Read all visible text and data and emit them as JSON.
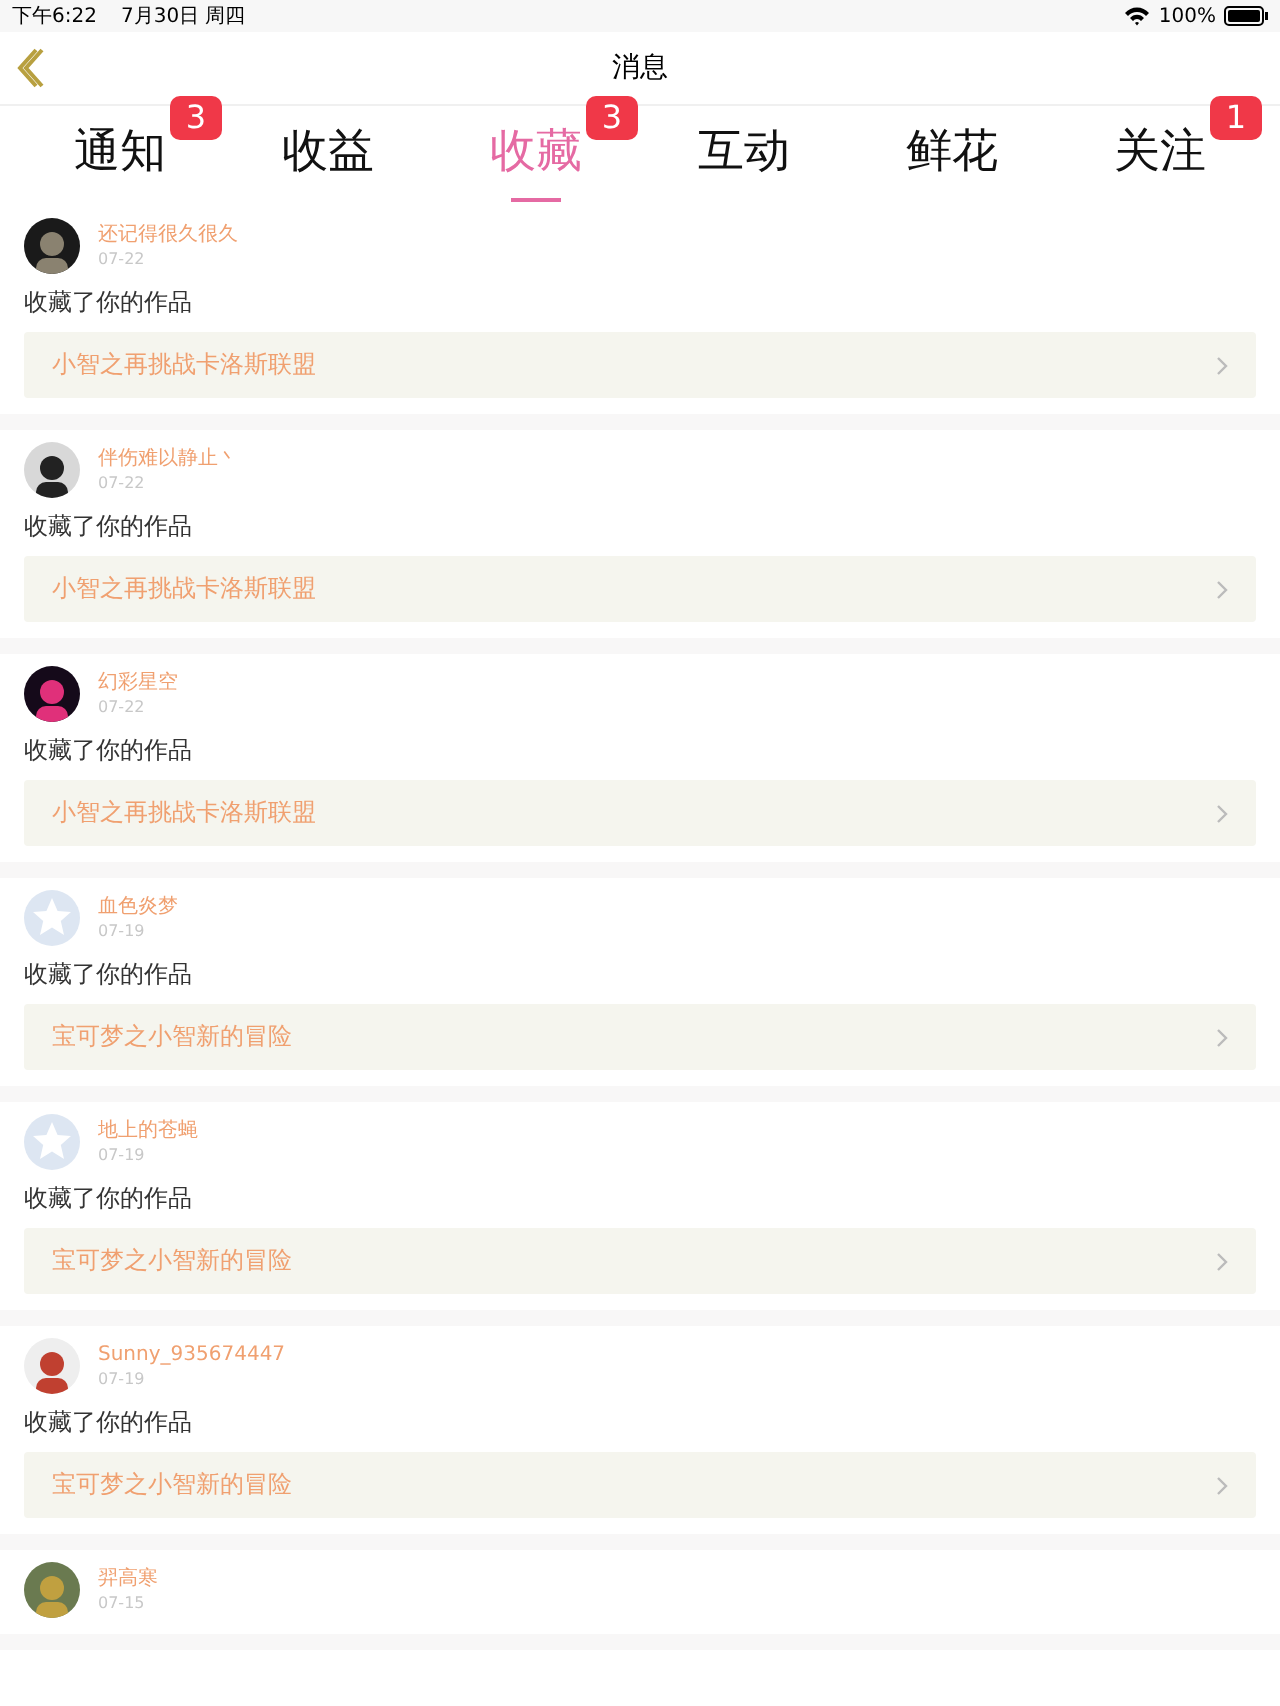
{
  "status_bar": {
    "time": "下午6:22",
    "date": "7月30日 周四",
    "battery": "100%"
  },
  "nav": {
    "title": "消息"
  },
  "tabs": [
    {
      "label": "通知",
      "selected": false,
      "badge": "3"
    },
    {
      "label": "收益",
      "selected": false
    },
    {
      "label": "收藏",
      "selected": true,
      "badge": "3"
    },
    {
      "label": "互动",
      "selected": false
    },
    {
      "label": "鲜花",
      "selected": false
    },
    {
      "label": "关注",
      "selected": false,
      "badge": "1"
    }
  ],
  "messages": [
    {
      "user": "还记得很久很久",
      "date": "07-22",
      "action": "收藏了你的作品",
      "work": "小智之再挑战卡洛斯联盟"
    },
    {
      "user": "伴伤难以静止丶",
      "date": "07-22",
      "action": "收藏了你的作品",
      "work": "小智之再挑战卡洛斯联盟"
    },
    {
      "user": "幻彩星空",
      "date": "07-22",
      "action": "收藏了你的作品",
      "work": "小智之再挑战卡洛斯联盟"
    },
    {
      "user": "血色炎梦",
      "date": "07-19",
      "avatar": {
        "kind": "default"
      },
      "action": "收藏了你的作品",
      "work": "宝可梦之小智新的冒险"
    },
    {
      "user": "地上的苍蝇",
      "date": "07-19",
      "avatar": {
        "kind": "default"
      },
      "action": "收藏了你的作品",
      "work": "宝可梦之小智新的冒险"
    },
    {
      "user": "Sunny_935674447",
      "date": "07-19",
      "action": "收藏了你的作品",
      "work": "宝可梦之小智新的冒险"
    },
    {
      "user": "羿高寒",
      "date": "07-15"
    }
  ]
}
